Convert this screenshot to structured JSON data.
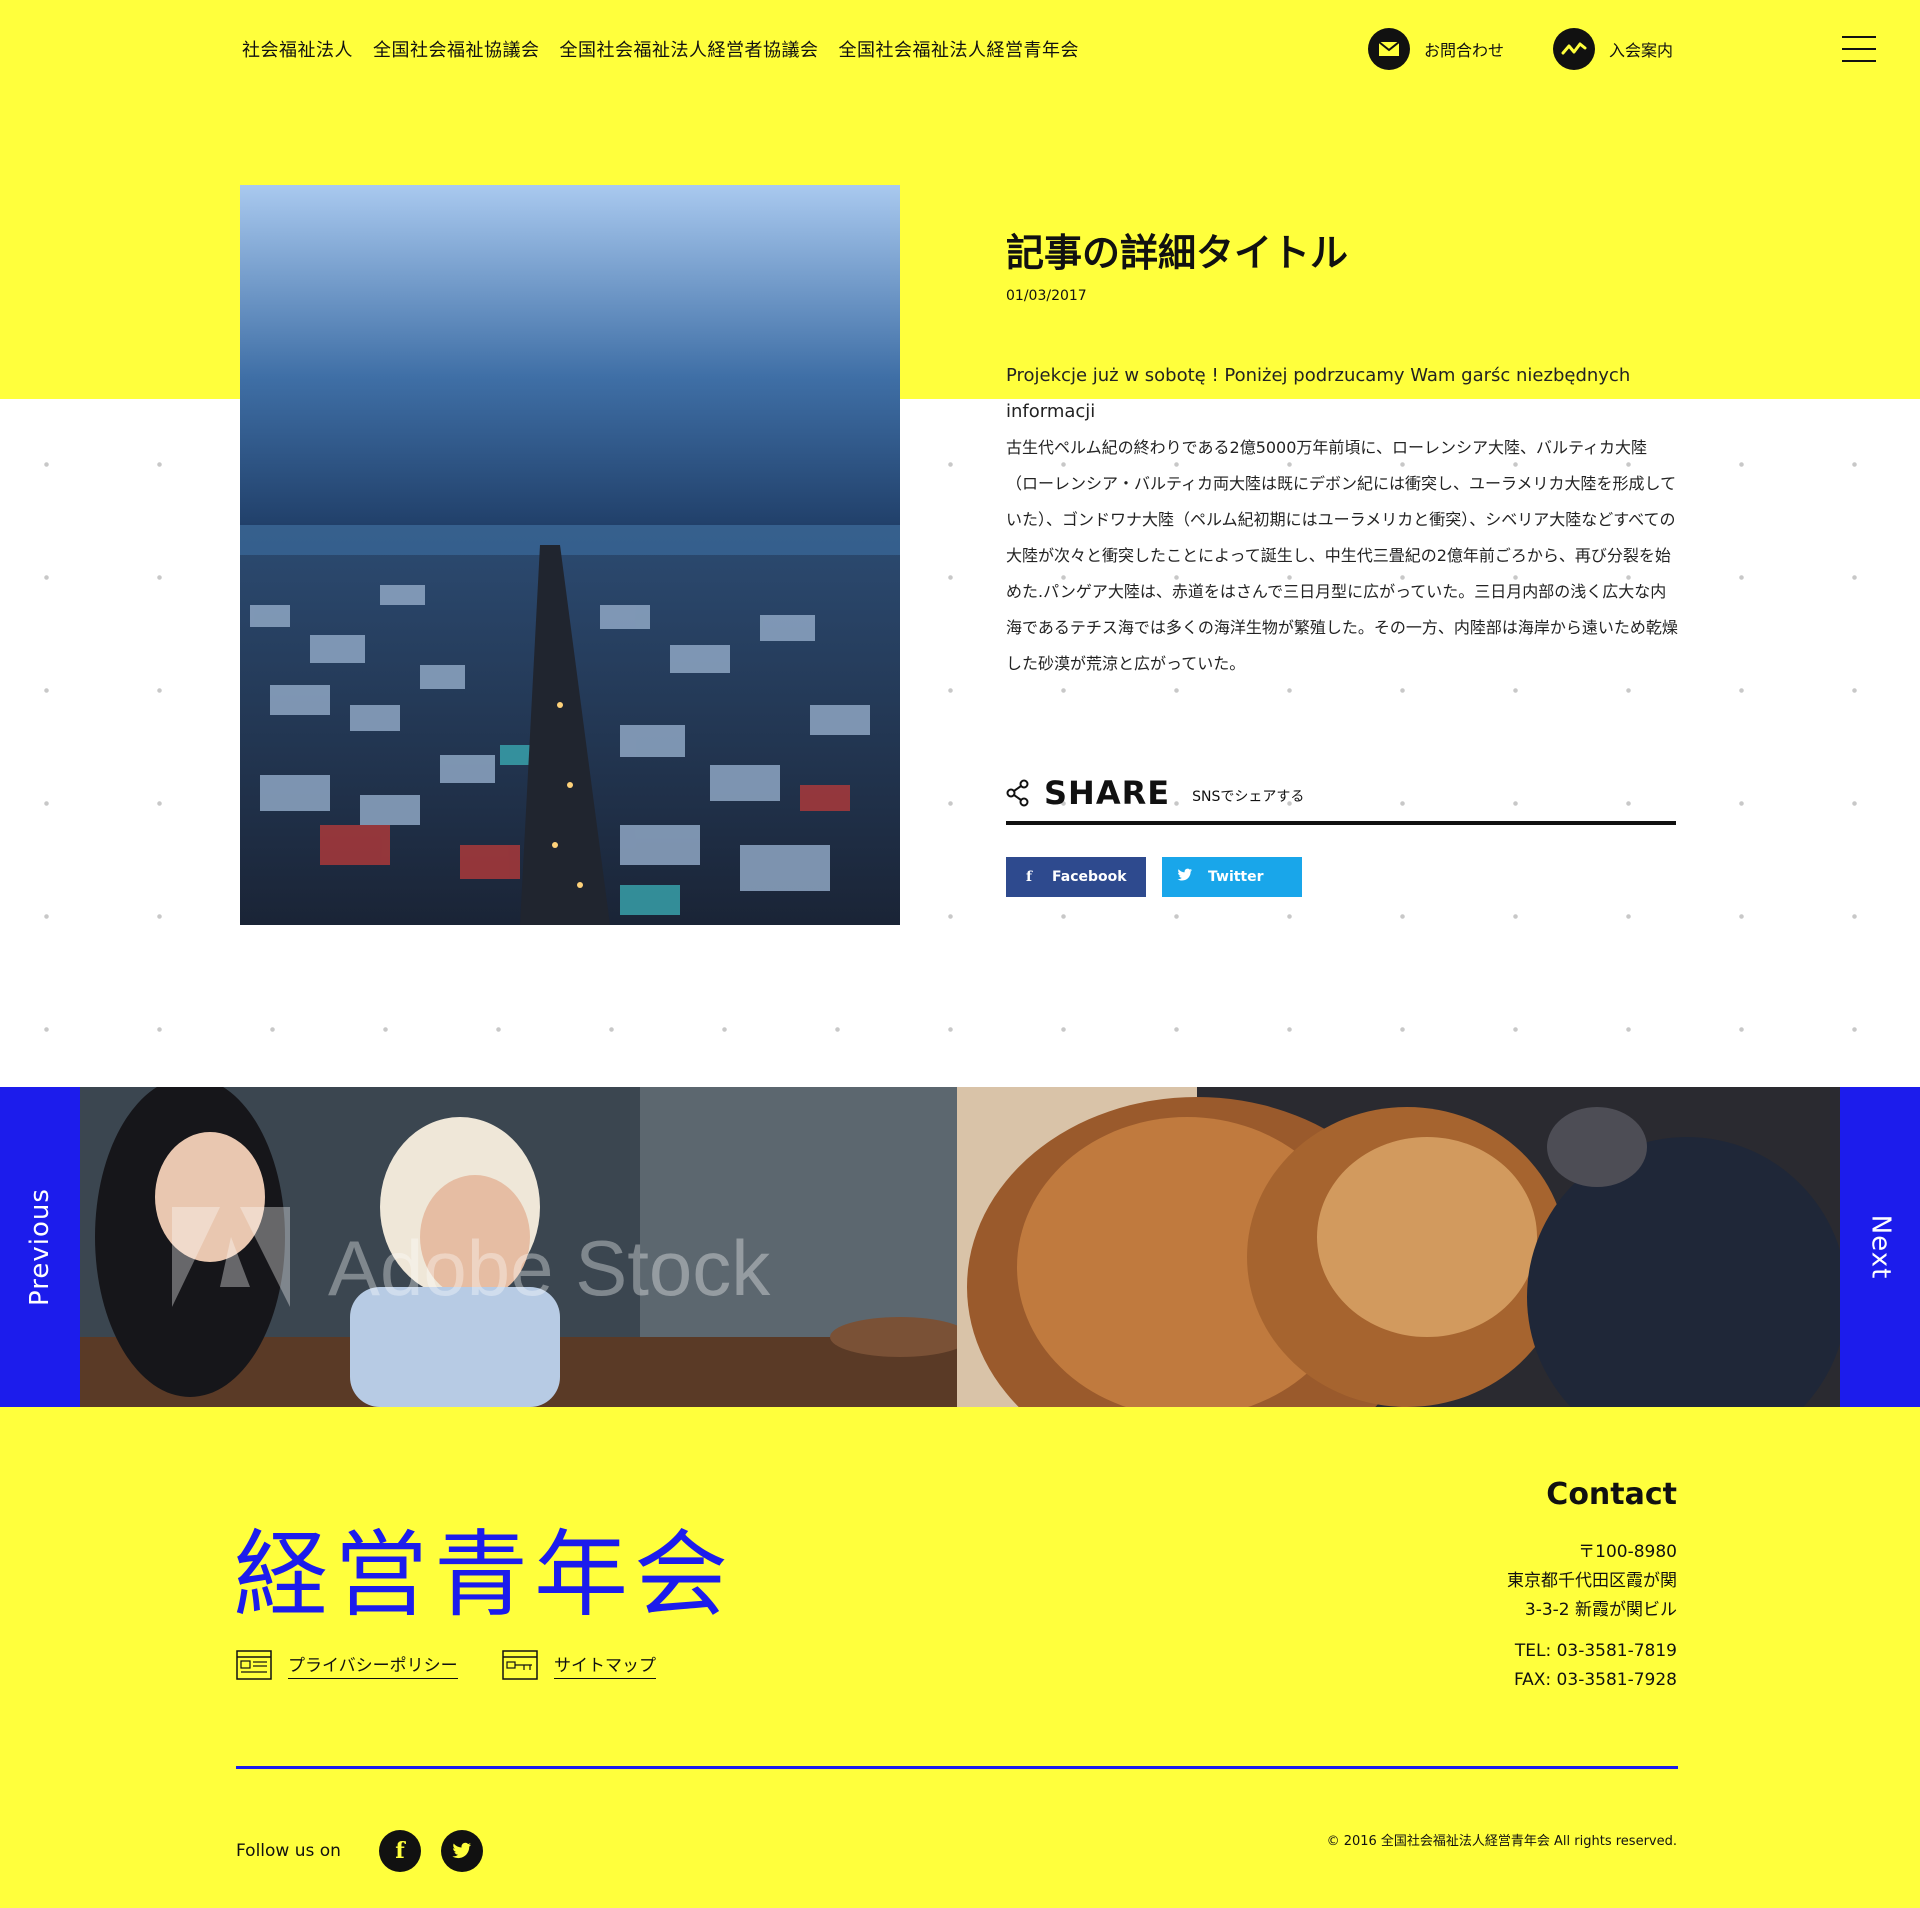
{
  "header": {
    "nav": [
      "社会福祉法人",
      "全国社会福祉協議会",
      "全国社会福祉法人経営者協議会",
      "全国社会福祉法人経営青年会"
    ],
    "contact_label": "お問合わせ",
    "join_label": "入会案内"
  },
  "article": {
    "title": "記事の詳細タイトル",
    "date": "01/03/2017",
    "lead": "Projekcje już w sobotę ! Poniżej podrzucamy Wam garśc niezbędnych informacji",
    "body": "古生代ペルム紀の終わりである2億5000万年前頃に、ローレンシア大陸、バルティカ大陸（ローレンシア・バルティカ両大陸は既にデボン紀には衝突し、ユーラメリカ大陸を形成していた）、ゴンドワナ大陸（ペルム紀初期にはユーラメリカと衝突）、シベリア大陸などすべての大陸が次々と衝突したことによって誕生し、中生代三畳紀の2億年前ごろから、再び分裂を始めた.パンゲア大陸は、赤道をはさんで三日月型に広がっていた。三日月内部の浅く広大な内海であるテチス海では多くの海洋生物が繁殖した。その一方、内陸部は海岸から遠いため乾燥した砂漠が荒涼と広がっていた。"
  },
  "share": {
    "title": "SHARE",
    "subtitle": "SNSでシェアする",
    "facebook_label": "Facebook",
    "twitter_label": "Twitter"
  },
  "pager": {
    "prev_label": "Previous",
    "next_label": "Next",
    "watermark": "Adobe Stock"
  },
  "footer": {
    "logo": "経営青年会",
    "privacy_label": "プライバシーポリシー",
    "sitemap_label": "サイトマップ",
    "contact": {
      "title": "Contact",
      "postal": "〒100-8980",
      "address1": "東京都千代田区霞が関",
      "address2": "3-3-2 新霞が関ビル",
      "tel": "TEL: 03-3581-7819",
      "fax": "FAX: 03-3581-7928"
    },
    "follow_label": "Follow us on",
    "copyright": "© 2016 全国社会福祉法人経営青年会 All rights reserved."
  },
  "colors": {
    "yellow": "#ffff3c",
    "blue": "#1c1cec",
    "facebook": "#2e4a8e",
    "twitter": "#19a6ea"
  }
}
